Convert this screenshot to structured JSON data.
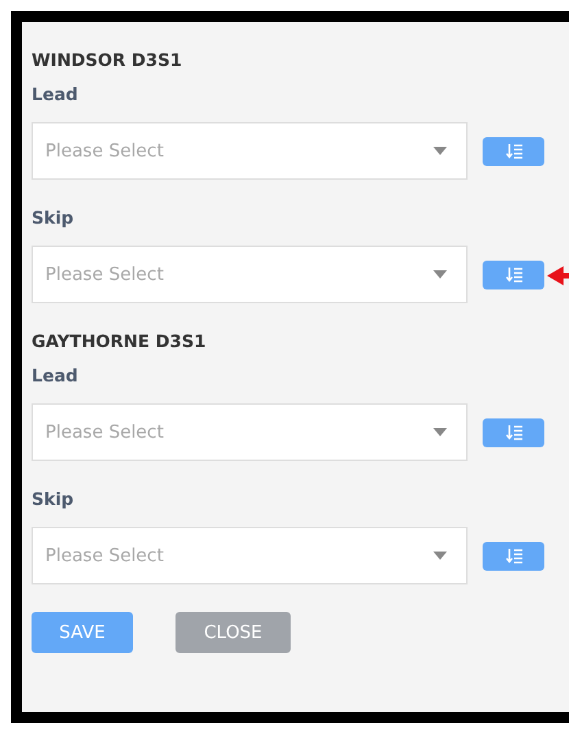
{
  "sections": [
    {
      "title": "WINDSOR D3S1",
      "fields": [
        {
          "label": "Lead",
          "placeholder": "Please Select",
          "annotated": false
        },
        {
          "label": "Skip",
          "placeholder": "Please Select",
          "annotated": true
        }
      ]
    },
    {
      "title": "GAYTHORNE D3S1",
      "fields": [
        {
          "label": "Lead",
          "placeholder": "Please Select",
          "annotated": false
        },
        {
          "label": "Skip",
          "placeholder": "Please Select",
          "annotated": false
        }
      ]
    }
  ],
  "buttons": [
    {
      "label": "SAVE",
      "kind": "primary"
    },
    {
      "label": "CLOSE",
      "kind": "secondary"
    }
  ]
}
